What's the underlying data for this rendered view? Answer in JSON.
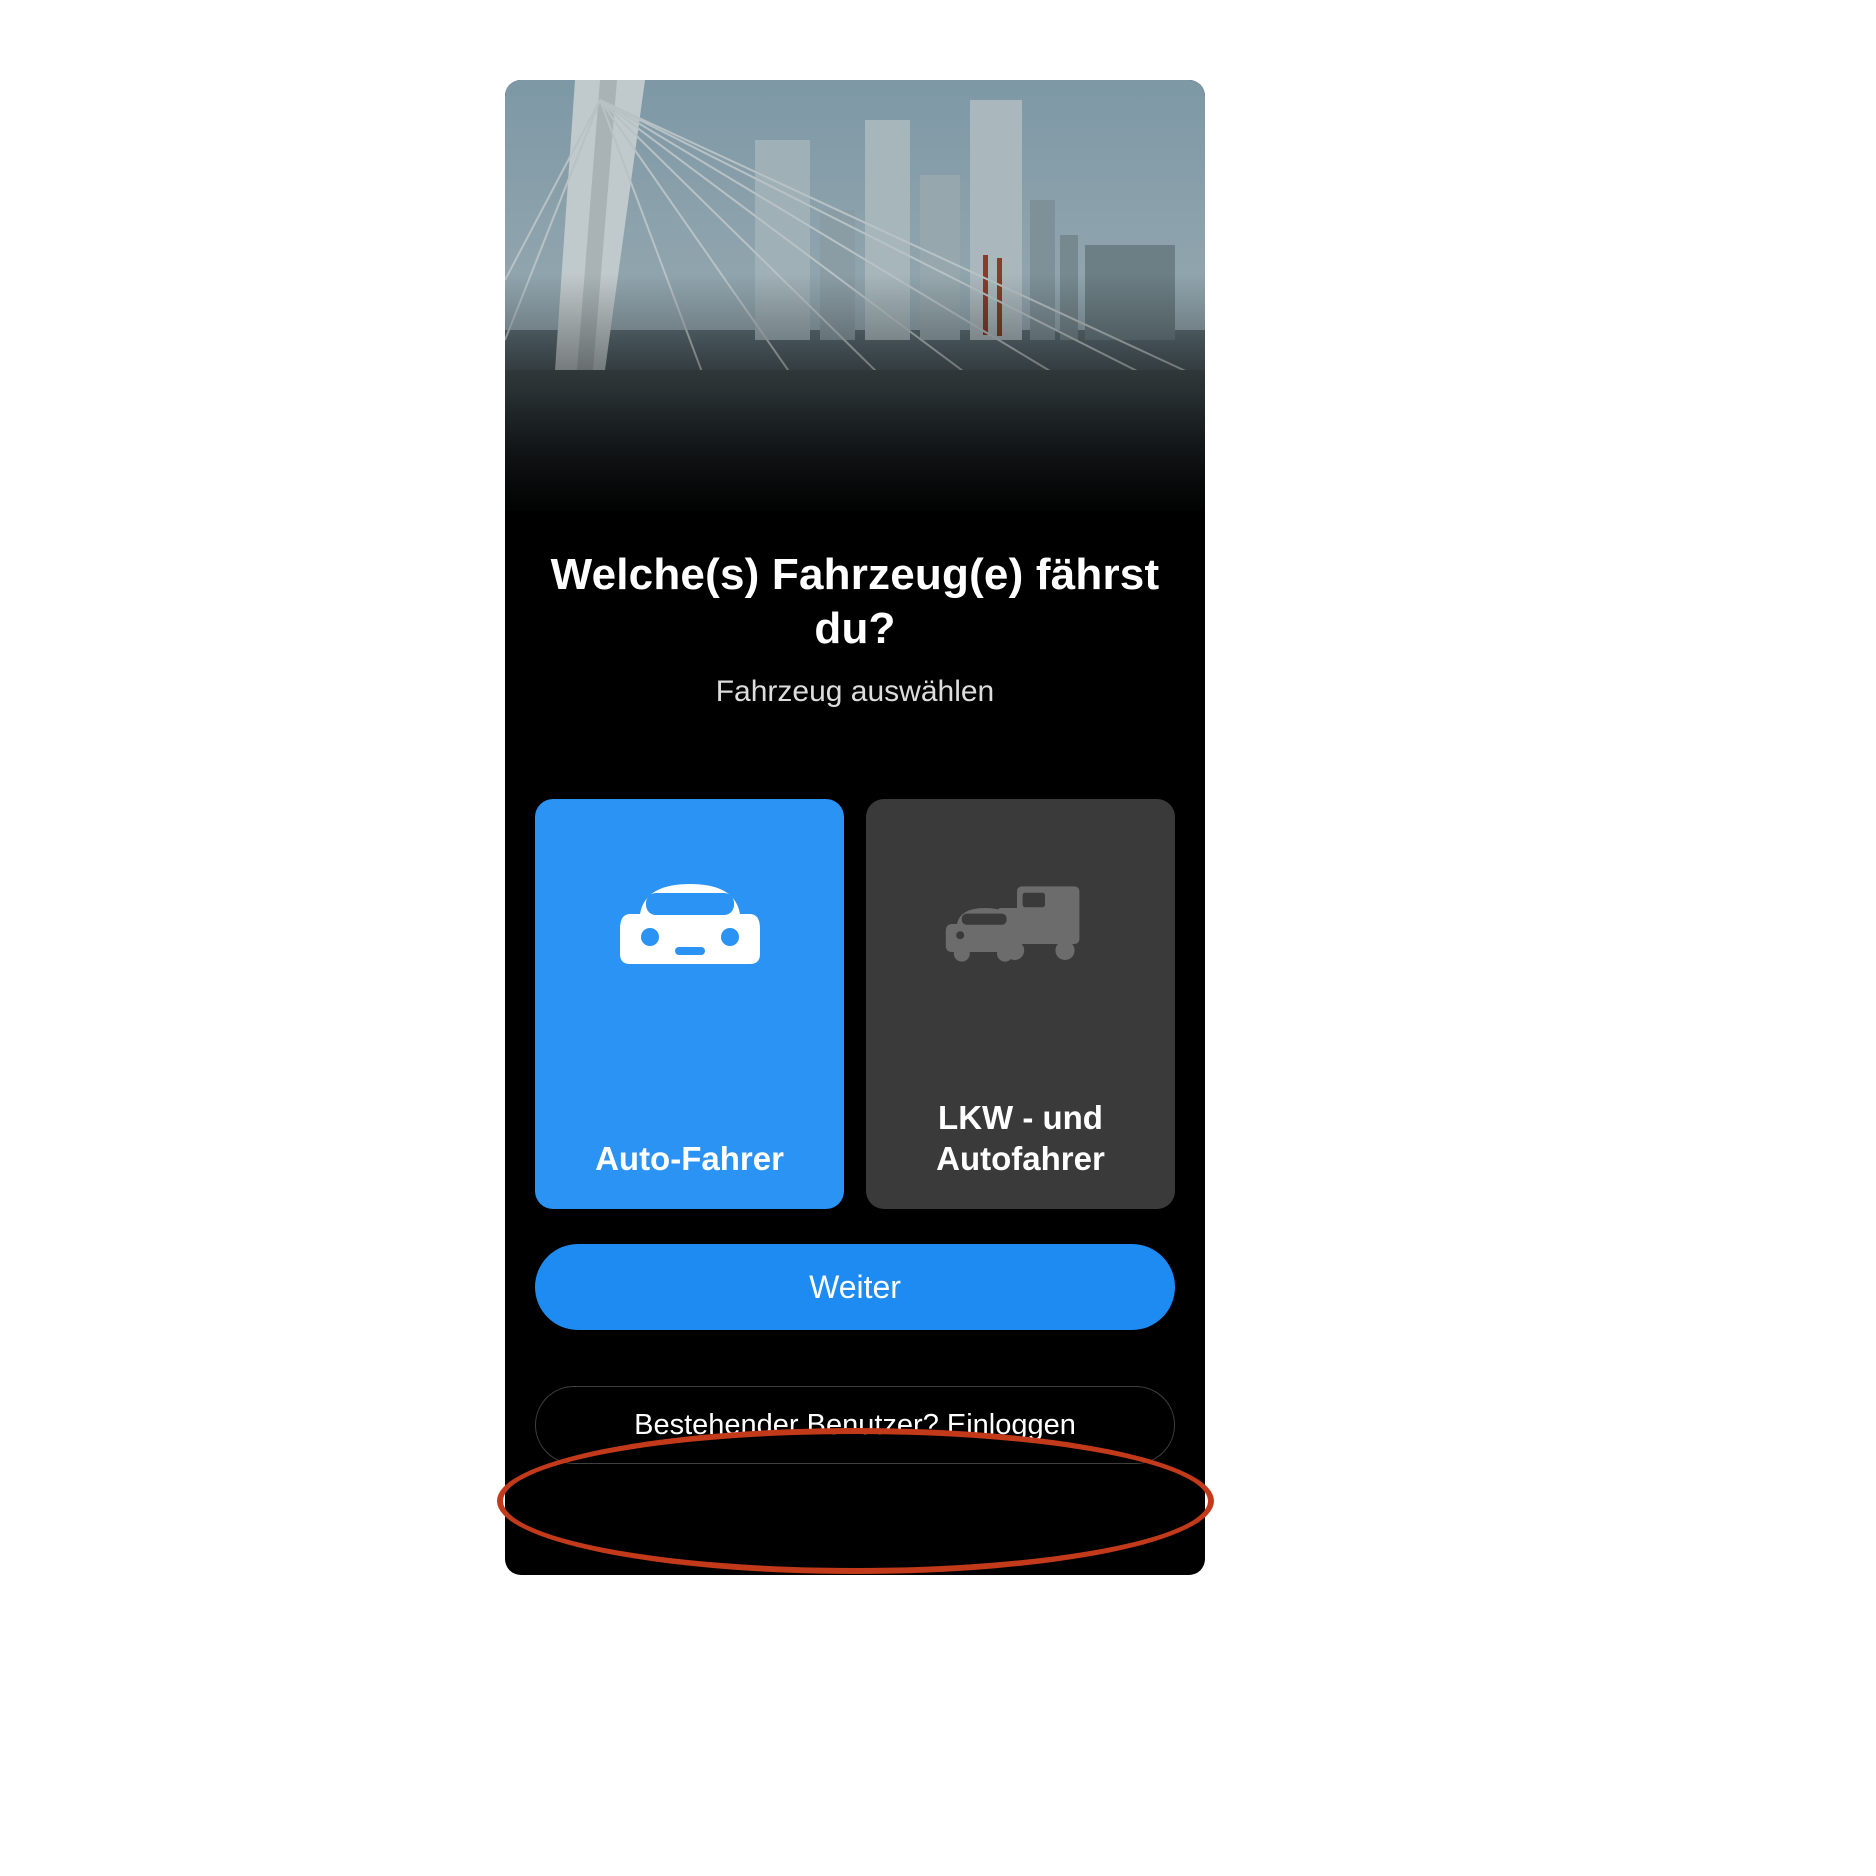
{
  "title": "Welche(s) Fahrzeug(e) fährst du?",
  "subtitle": "Fahrzeug auswählen",
  "options": [
    {
      "id": "car",
      "label": "Auto-Fahrer",
      "selected": true,
      "icon": "car-icon"
    },
    {
      "id": "truck-and-car",
      "label": "LKW - und Autofahrer",
      "selected": false,
      "icon": "car-truck-icon"
    }
  ],
  "primary_action": "Weiter",
  "secondary_action": "Bestehender Benutzer? Einloggen",
  "colors": {
    "accent": "#2a93f4",
    "card_alt": "#3a3a3a",
    "annotation": "#c23a1a"
  },
  "annotation": {
    "target": "secondary_action",
    "shape": "ellipse"
  }
}
